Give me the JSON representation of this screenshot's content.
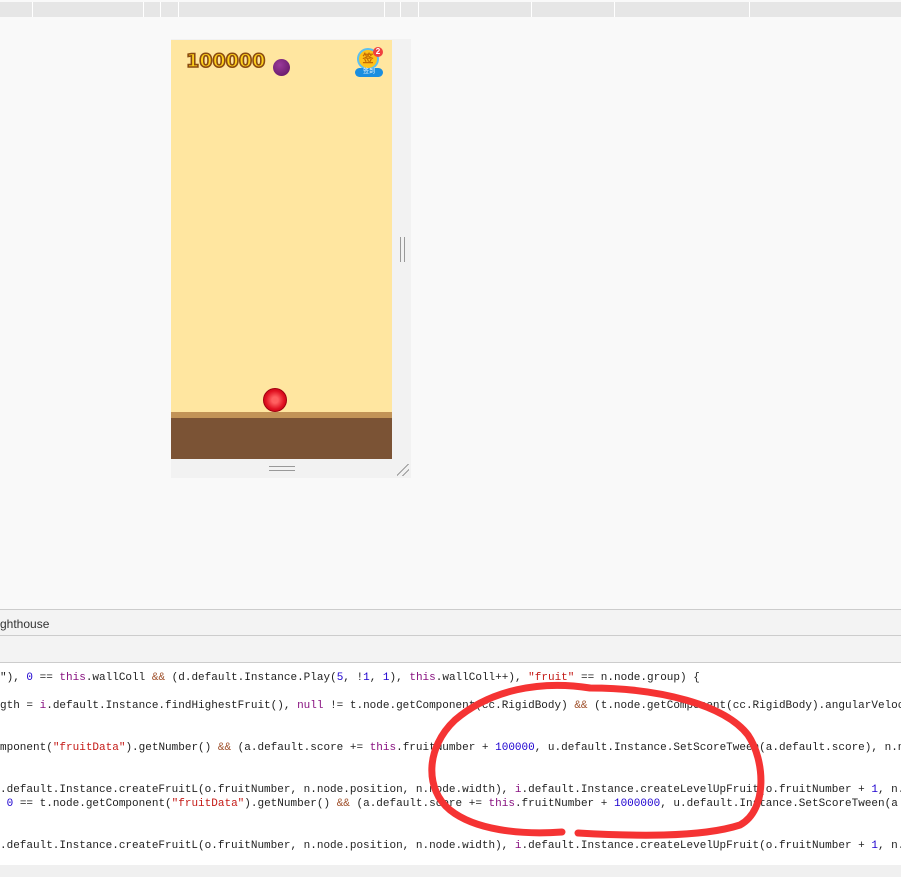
{
  "game": {
    "score": "100000",
    "badge_char": "签",
    "badge_count": "2",
    "badge_label": "签到"
  },
  "devtools": {
    "tab_label": "ghthouse"
  },
  "code_lines": [
    [
      [
        "\"), "
      ],
      [
        "0",
        "num"
      ],
      [
        " == "
      ],
      [
        "this",
        "kw"
      ],
      [
        ".wallColl "
      ],
      [
        "&&",
        "op"
      ],
      [
        " (d.default.Instance.Play("
      ],
      [
        "5",
        "num"
      ],
      [
        ", !"
      ],
      [
        "1",
        "num"
      ],
      [
        ", "
      ],
      [
        "1",
        "num"
      ],
      [
        "), "
      ],
      [
        "this",
        "kw"
      ],
      [
        ".wallColl++), "
      ],
      [
        "\"fruit\"",
        "str"
      ],
      [
        " == n.node.group) {"
      ]
    ],
    [
      [
        "gth = "
      ],
      [
        "i",
        "kw"
      ],
      [
        ".default.Instance.findHighestFruit(), "
      ],
      [
        "null",
        "kw"
      ],
      [
        " != t.node.getComponent(cc.RigidBody) "
      ],
      [
        "&&",
        "op"
      ],
      [
        " (t.node.getComponent(cc.RigidBody).angularVeloc"
      ]
    ],
    [
      [
        "mponent("
      ],
      [
        "\"fruitData\"",
        "str"
      ],
      [
        ").getNumber() "
      ],
      [
        "&&",
        "op"
      ],
      [
        " (a.default.score += "
      ],
      [
        "this",
        "kw"
      ],
      [
        ".fruitNumber + "
      ],
      [
        "100000",
        "num"
      ],
      [
        ", u.default.Instance.SetScoreTween(a.default.score), n.n"
      ]
    ],
    [
      [
        ".default.Instance.createFruitL(o.fruitNumber, n.node.position, n.node.width), "
      ],
      [
        "i",
        "kw"
      ],
      [
        ".default.Instance.createLevelUpFruit(o.fruitNumber + "
      ],
      [
        "1",
        "num"
      ],
      [
        ", n."
      ]
    ],
    [
      [
        " "
      ],
      [
        "0",
        "num"
      ],
      [
        " == t.node.getComponent("
      ],
      [
        "\"fruitData\"",
        "str"
      ],
      [
        ").getNumber() "
      ],
      [
        "&&",
        "op"
      ],
      [
        " (a.default.score += "
      ],
      [
        "this",
        "kw"
      ],
      [
        ".fruitNumber + "
      ],
      [
        "1000000",
        "num"
      ],
      [
        ", u.default.Instance.SetScoreTween(a"
      ]
    ],
    [
      [
        ".default.Instance.createFruitL(o.fruitNumber, n.node.position, n.node.width), "
      ],
      [
        "i",
        "kw"
      ],
      [
        ".default.Instance.createLevelUpFruit(o.fruitNumber + "
      ],
      [
        "1",
        "num"
      ],
      [
        ", n."
      ]
    ]
  ],
  "colors": {
    "annotation": "#f53333",
    "game_bg": "#ffe6a0",
    "ground": "#7b5335"
  }
}
